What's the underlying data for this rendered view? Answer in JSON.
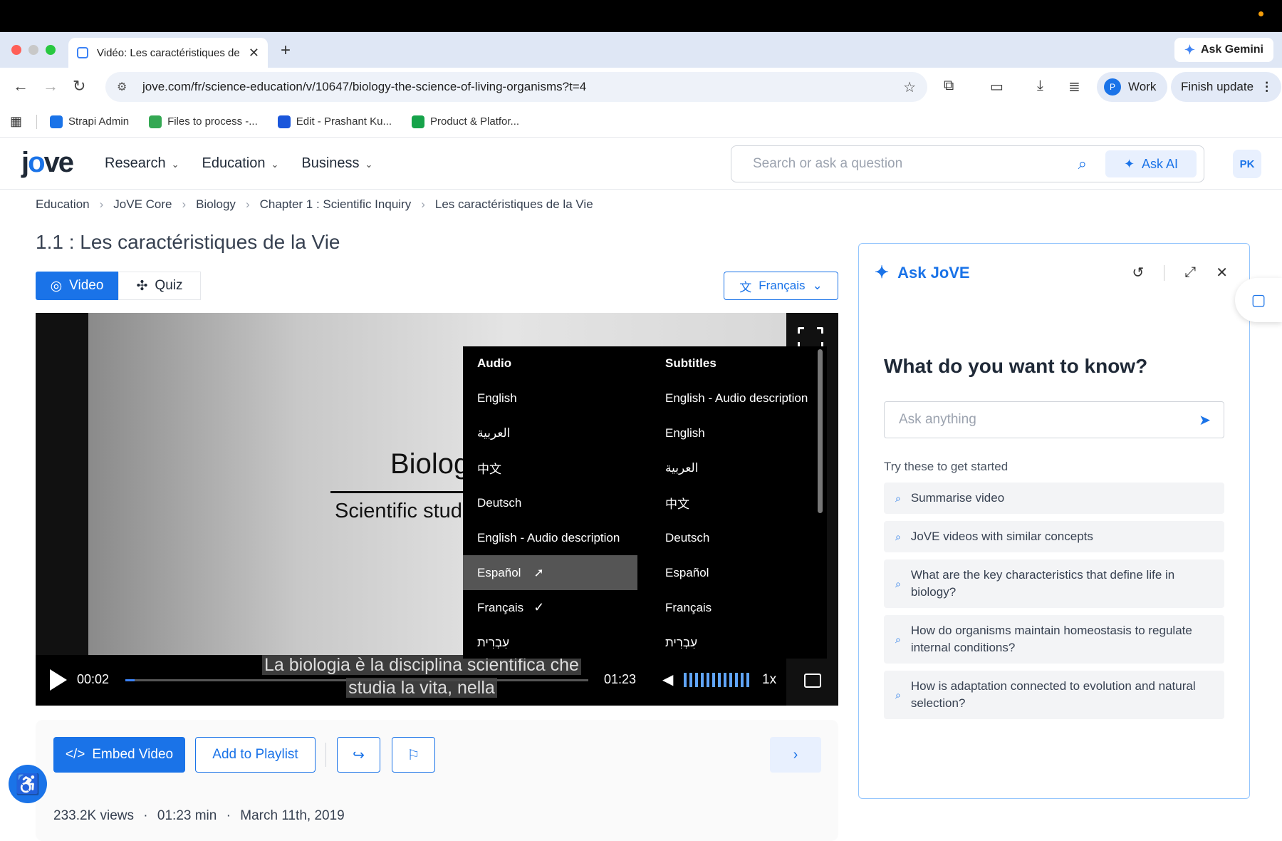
{
  "browser": {
    "tab_title": "Vidéo: Les caractéristiques de",
    "new_tab": "+",
    "ask_gemini": "Ask Gemini",
    "url": "jove.com/fr/science-education/v/10647/biology-the-science-of-living-organisms?t=4",
    "profile_initial": "P",
    "profile_label": "Work",
    "finish_update": "Finish update",
    "bookmarks": [
      {
        "label": "Strapi Admin",
        "color": "#1a73e8"
      },
      {
        "label": "Files to process -...",
        "color": "#34a853"
      },
      {
        "label": "Edit - Prashant Ku...",
        "color": "#1a56db"
      },
      {
        "label": "Product & Platfor...",
        "color": "#16a34a"
      }
    ]
  },
  "site": {
    "logo_pre": "j",
    "logo_o": "o",
    "logo_post": "ve",
    "nav": [
      "Research",
      "Education",
      "Business"
    ],
    "search_placeholder": "Search or ask a question",
    "ask_ai": "Ask AI",
    "user_initials": "PK"
  },
  "breadcrumb": [
    "Education",
    "JoVE Core",
    "Biology",
    "Chapter 1 : Scientific Inquiry",
    "Les caractéristiques de la Vie"
  ],
  "page_title": "1.1 : Les caractéristiques de la Vie",
  "tabs": {
    "video": "Video",
    "quiz": "Quiz"
  },
  "language_select": "Français",
  "player": {
    "slide_title": "Biolog",
    "slide_subtitle": "Scientific stud",
    "current_time": "00:02",
    "duration": "01:23",
    "speed": "1x",
    "progress": 0.02,
    "caption_line1": "La biologia è la disciplina scientifica che",
    "caption_line2": "studia la vita, nella",
    "menu": {
      "audio_header": "Audio",
      "audio_options": [
        "English",
        "العربية",
        "中文",
        "Deutsch",
        "English - Audio description",
        "Español",
        "Français",
        "עִבְרִית"
      ],
      "audio_hover": "Español",
      "audio_selected": "Français",
      "subtitles_header": "Subtitles",
      "subtitle_options": [
        "English - Audio description",
        "English",
        "العربية",
        "中文",
        "Deutsch",
        "Español",
        "Français",
        "עִבְרִית"
      ]
    }
  },
  "actions": {
    "embed": "Embed Video",
    "playlist": "Add to Playlist"
  },
  "meta": {
    "views": "233.2K views",
    "length": "01:23 min",
    "date": "March 11th, 2019",
    "dot": "·"
  },
  "ask_jove": {
    "title": "Ask JoVE",
    "question": "What do you want to know?",
    "input_placeholder": "Ask anything",
    "try_label": "Try these to get started",
    "suggestions": [
      "Summarise video",
      "JoVE videos with similar concepts",
      "What are the key characteristics that define life in biology?",
      "How do organisms maintain homeostasis to regulate internal conditions?",
      "How is adaptation connected to evolution and natural selection?"
    ]
  }
}
